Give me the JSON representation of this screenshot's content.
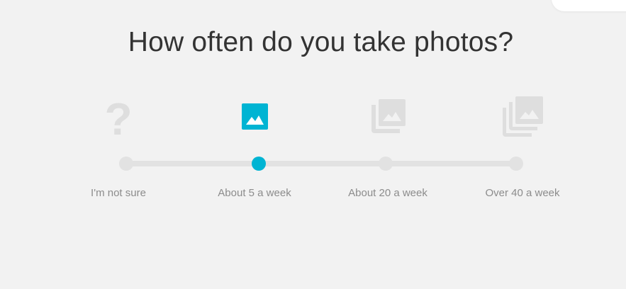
{
  "question": "How often do you take photos?",
  "colors": {
    "background": "#f2f2f2",
    "accent": "#00b4d3",
    "inactive_icon": "#dedede",
    "track": "#e2e2e2",
    "label": "#8c8c8c",
    "heading": "#333333"
  },
  "slider": {
    "selected_index": 1,
    "options": [
      {
        "label": "I'm not sure",
        "icon": "question-mark-icon"
      },
      {
        "label": "About 5 a week",
        "icon": "single-photo-icon"
      },
      {
        "label": "About 20 a week",
        "icon": "photo-stack-icon"
      },
      {
        "label": "Over 40 a week",
        "icon": "large-photo-stack-icon"
      }
    ]
  }
}
